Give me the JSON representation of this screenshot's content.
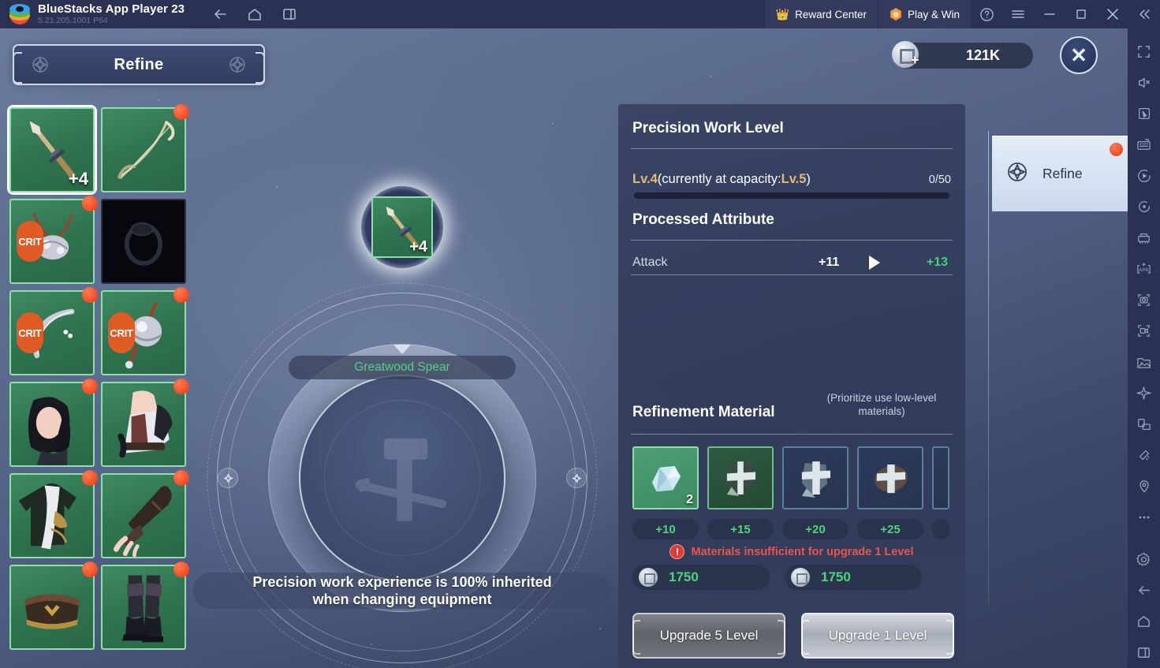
{
  "bluestacks": {
    "title": "BlueStacks App Player 23",
    "version": "5.21.205.1001  P64",
    "nav": [
      {
        "name": "back-icon",
        "label": "Back"
      },
      {
        "name": "home-icon",
        "label": "Home"
      },
      {
        "name": "multi-instance-icon",
        "label": "Instances"
      }
    ],
    "reward_center": "Reward Center",
    "play_and_win": "Play & Win",
    "window_controls": [
      "help-icon",
      "menu-icon",
      "minimize-icon",
      "maximize-icon",
      "close-icon",
      "collapse-icon"
    ],
    "toolbar_icons": [
      "fullscreen-icon",
      "mute-icon",
      "cursor-icon",
      "keymapping-icon",
      "macro-record-icon",
      "sync-operations-icon",
      "multi-instance-manager-icon",
      "install-apk-icon",
      "screenshot-icon",
      "screen-record-icon",
      "media-manager-icon",
      "airplane-icon",
      "rotate-screen-icon",
      "shake-icon",
      "location-icon",
      "more-icon",
      "settings-icon",
      "back-icon",
      "home-icon",
      "recents-icon"
    ]
  },
  "game": {
    "header_tab": "Refine",
    "currency": {
      "amount": "121K",
      "icon": "coin-icon",
      "add": "+"
    },
    "close_label": "✕",
    "side_tab": {
      "label": "Refine",
      "icon": "refine-diamond-icon",
      "badge": true
    },
    "inventory": [
      {
        "name": "greatwood-spear",
        "art": "spear",
        "enhance": "+4",
        "selected": true,
        "badge": false,
        "rarity": "green"
      },
      {
        "name": "bow",
        "art": "bow",
        "badge": true,
        "rarity": "green"
      },
      {
        "name": "crit-necklace",
        "art": "necklace",
        "tag": "CRIT",
        "badge": true,
        "rarity": "green"
      },
      {
        "name": "empty-ring-slot",
        "art": "ring-dark",
        "badge": false,
        "rarity": "dark"
      },
      {
        "name": "crit-bracelet",
        "art": "bracelet",
        "tag": "CRIT",
        "badge": true,
        "rarity": "green"
      },
      {
        "name": "crit-ornament",
        "art": "ornament",
        "tag": "CRIT",
        "badge": true,
        "rarity": "green"
      },
      {
        "name": "headwear",
        "art": "head",
        "badge": true,
        "rarity": "green"
      },
      {
        "name": "shoulder",
        "art": "shoulder",
        "badge": true,
        "rarity": "green"
      },
      {
        "name": "chest-robe",
        "art": "robe",
        "badge": true,
        "rarity": "green"
      },
      {
        "name": "gloves",
        "art": "glove",
        "badge": true,
        "rarity": "green"
      },
      {
        "name": "belt",
        "art": "belt",
        "badge": true,
        "rarity": "green"
      },
      {
        "name": "boots",
        "art": "boots",
        "badge": true,
        "rarity": "green"
      }
    ],
    "center": {
      "item_enhance": "+4",
      "item_name": "Greatwood Spear",
      "hint": "Precision work experience is 100% inherited\nwhen changing equipment"
    },
    "panel": {
      "precision_title": "Precision Work Level",
      "level_prefix": "Lv.4",
      "level_mid": " (currently at capacity: ",
      "level_cap": "Lv.5",
      "level_suffix": ")",
      "exp_fraction": "0/50",
      "attribute_title": "Processed Attribute",
      "attribute": {
        "name": "Attack",
        "current": "+11",
        "next": "+13"
      },
      "material_title": "Refinement Material",
      "material_note": "(Prioritize use low-level materials)",
      "materials": [
        {
          "name": "crystal-shard",
          "count": "2",
          "value": "+10",
          "state": "selected"
        },
        {
          "name": "stone-ore-a",
          "count": "",
          "value": "+15",
          "state": "green"
        },
        {
          "name": "stone-ore-b",
          "count": "",
          "value": "+20",
          "state": "normal"
        },
        {
          "name": "stone-ore-c",
          "count": "",
          "value": "+25",
          "state": "normal"
        },
        {
          "name": "stone-ore-d",
          "count": "",
          "value": "",
          "state": "clipped"
        }
      ],
      "warning": "Materials insufficient for upgrade 1 Level",
      "costs": [
        {
          "icon": "coin-icon",
          "amount": "1750"
        },
        {
          "icon": "coin-icon",
          "amount": "1750"
        }
      ],
      "buttons": [
        {
          "name": "upgrade-5-level-button",
          "label": "Upgrade 5 Level",
          "state": "disabled"
        },
        {
          "name": "upgrade-1-level-button",
          "label": "Upgrade 1 Level",
          "state": "enabled"
        }
      ]
    }
  },
  "colors": {
    "accent_gold": "#e3b974",
    "accent_green": "#4fd37e",
    "warning_red": "#e8554e",
    "rarity_green": "#8fe0a8",
    "titlebar": "#2b3152"
  }
}
